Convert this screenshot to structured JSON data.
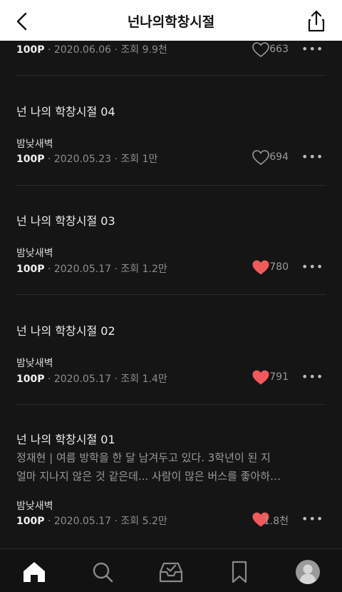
{
  "header": {
    "title": "넌나의학창시절"
  },
  "episodes": [
    {
      "title": "",
      "author": "",
      "price": "100P",
      "date": "2020.06.06",
      "views": "조회 9.9천",
      "likes": "663",
      "liked": false
    },
    {
      "title": "넌 나의 학창시절 04",
      "author": "밤낮새벽",
      "price": "100P",
      "date": "2020.05.23",
      "views": "조회 1만",
      "likes": "694",
      "liked": false
    },
    {
      "title": "넌 나의 학창시절 03",
      "author": "밤낮새벽",
      "price": "100P",
      "date": "2020.05.17",
      "views": "조회 1.2만",
      "likes": "780",
      "liked": true
    },
    {
      "title": "넌 나의 학창시절 02",
      "author": "밤낮새벽",
      "price": "100P",
      "date": "2020.05.17",
      "views": "조회 1.4만",
      "likes": "791",
      "liked": true
    },
    {
      "title": "넌 나의 학창시절 01",
      "excerpt": "정재현 | 여름 방학을 한 달 남겨두고 있다. 3학년이 된 지\n얼마 지나지 않은 것 같은데... 사람이 많은 버스를 좋아하…",
      "author": "밤낮새벽",
      "price": "100P",
      "date": "2020.05.17",
      "views": "조회 5.2만",
      "likes": "1.8천",
      "liked": true
    }
  ],
  "meta_separator": "·",
  "more_label": "•••",
  "colors": {
    "liked_heart": "#f05a5a",
    "unliked_heart": "#9a9a9a",
    "header_bg": "#ffffff",
    "page_bg": "#151515"
  },
  "tabbar": {
    "tabs": [
      "home-icon",
      "search-icon",
      "inbox-icon",
      "bookmark-icon",
      "profile-icon"
    ],
    "active": "home-icon"
  }
}
